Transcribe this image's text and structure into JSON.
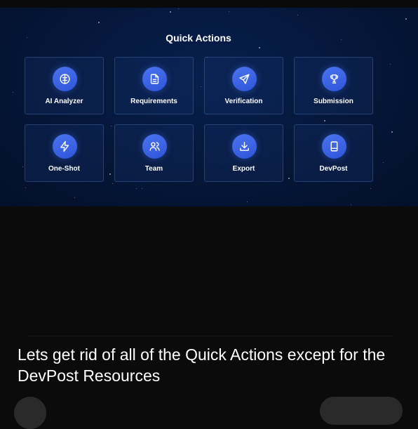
{
  "quick_actions": {
    "title": "Quick Actions",
    "items": [
      {
        "label": "AI Analyzer",
        "icon": "brain-icon"
      },
      {
        "label": "Requirements",
        "icon": "document-icon"
      },
      {
        "label": "Verification",
        "icon": "send-icon"
      },
      {
        "label": "Submission",
        "icon": "trophy-icon"
      },
      {
        "label": "One-Shot",
        "icon": "lightning-icon"
      },
      {
        "label": "Team",
        "icon": "users-icon"
      },
      {
        "label": "Export",
        "icon": "download-icon"
      },
      {
        "label": "DevPost",
        "icon": "book-icon"
      }
    ]
  },
  "chat": {
    "message": "Lets get rid of all of the Quick Actions except for the DevPost Resources"
  },
  "colors": {
    "panel_background": "#051638",
    "icon_accent": "#3b63e6",
    "page_background": "#0b0b0b",
    "text": "#ffffff"
  }
}
